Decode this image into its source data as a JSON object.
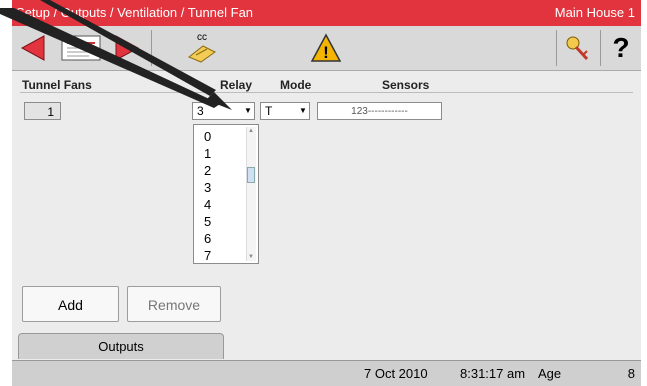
{
  "title_bar": {
    "breadcrumb": "Setup / Outputs / Ventilation / Tunnel Fan",
    "house": "Main House 1",
    "bg_color": "#e2343e"
  },
  "toolbar": {
    "icons": [
      "arrow-left-icon",
      "list-icon",
      "arrow-right-icon",
      "cc-copy-icon",
      "warning-icon",
      "key-icon",
      "help-icon"
    ],
    "cc_label": "cc",
    "help_label": "?",
    "warning_label": "!"
  },
  "table": {
    "headers": {
      "tunnel_fans": "Tunnel Fans",
      "relay": "Relay",
      "mode": "Mode",
      "sensors": "Sensors"
    },
    "row": {
      "index": "1",
      "relay": "3",
      "mode": "T",
      "sensors": "123------------"
    }
  },
  "relay_dropdown": {
    "options": [
      "0",
      "1",
      "2",
      "3",
      "4",
      "5",
      "6",
      "7"
    ]
  },
  "buttons": {
    "add": "Add",
    "remove": "Remove"
  },
  "tab": {
    "label": "Outputs"
  },
  "status_bar": {
    "date": "7 Oct 2010",
    "time": "8:31:17 am",
    "age_label": "Age",
    "age_value": "8"
  }
}
